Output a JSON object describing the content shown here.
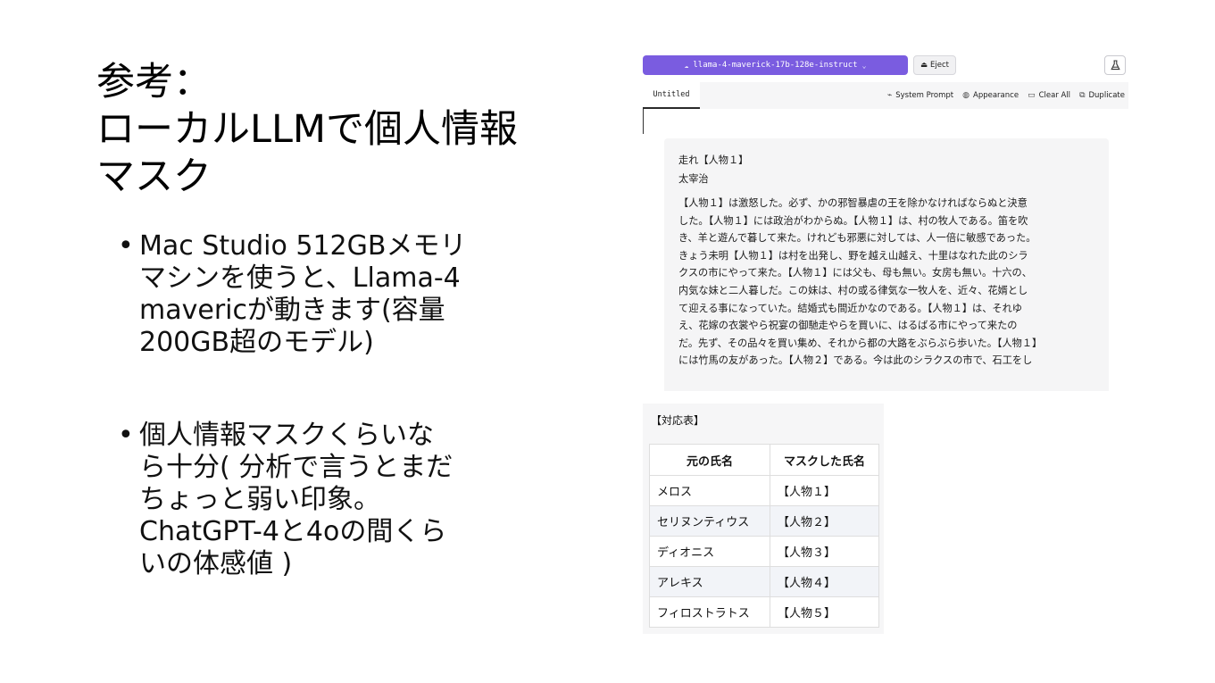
{
  "slide": {
    "title_lines": [
      "参考：",
      "ローカルLLMで個人情報",
      "マスク"
    ],
    "bullets": [
      {
        "lines": [
          "Mac Studio 512GBメモリ",
          "マシンを使うと、Llama-4",
          "mavericが動きます(容量",
          "200GB超のモデル)"
        ]
      },
      {
        "lines": [
          "個人情報マスクくらいな",
          "ら十分( 分析で言うとまだ",
          "ちょっと弱い印象。",
          "ChatGPT-4と4oの間くら",
          "いの体感値 )"
        ]
      }
    ],
    "bullet_glyph": "•"
  },
  "app": {
    "model_name": "llama-4-maverick-17b-128e-instruct",
    "model_icon": "cloud-icon",
    "eject_label": "Eject",
    "flask_icon": "flask-icon",
    "tab_label": "Untitled",
    "actions": {
      "system_prompt": "System Prompt",
      "appearance": "Appearance",
      "clear_all": "Clear All",
      "duplicate": "Duplicate"
    },
    "message": {
      "heading_lines": [
        "走れ【人物１】",
        "太宰治"
      ],
      "paragraph_lines": [
        "【人物１】は激怒した。必ず、かの邪智暴虐の王を除かなければならぬと決意",
        "した。【人物１】には政治がわからぬ。【人物１】は、村の牧人である。笛を吹",
        "き、羊と遊んで暮して来た。けれども邪悪に対しては、人一倍に敏感であった。",
        "きょう未明【人物１】は村を出発し、野を越え山越え、十里はなれた此のシラ",
        "クスの市にやって来た。【人物１】には父も、母も無い。女房も無い。十六の、",
        "内気な妹と二人暮しだ。この妹は、村の或る律気な一牧人を、近々、花婿とし",
        "て迎える事になっていた。結婚式も間近かなのである。【人物１】は、それゆ",
        "え、花嫁の衣裳やら祝宴の御馳走やらを買いに、はるばる市にやって来たの",
        "だ。先ず、その品々を買い集め、それから都の大路をぶらぶら歩いた。【人物１】",
        "には竹馬の友があった。【人物２】である。今は此のシラクスの市で、石工をし"
      ]
    }
  },
  "mapping": {
    "title": "【対応表】",
    "headers": [
      "元の氏名",
      "マスクした氏名"
    ],
    "rows": [
      [
        "メロス",
        "【人物１】"
      ],
      [
        "セリヌンティウス",
        "【人物２】"
      ],
      [
        "ディオニス",
        "【人物３】"
      ],
      [
        "アレキス",
        "【人物４】"
      ],
      [
        "フィロストラトス",
        "【人物５】"
      ]
    ]
  }
}
